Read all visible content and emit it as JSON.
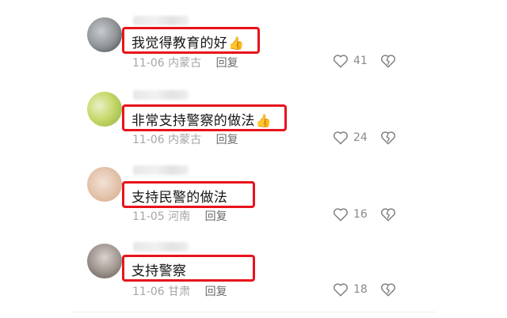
{
  "comments": [
    {
      "text": "我觉得教育的好",
      "has_thumb": true,
      "thumb_glyph": "👍",
      "date": "11-06",
      "location": "内蒙古",
      "reply_label": "回复",
      "likes": "41",
      "avatar_colors": [
        "#bfc3c6",
        "#8b8f93",
        "#3b3d40"
      ]
    },
    {
      "text": "非常支持警察的做法",
      "has_thumb": true,
      "thumb_glyph": "👍",
      "date": "11-06",
      "location": "内蒙古",
      "reply_label": "回复",
      "likes": "24",
      "avatar_colors": [
        "#cfe07a",
        "#9fbf4a",
        "#e9efc9"
      ]
    },
    {
      "text": "支持民警的做法",
      "has_thumb": false,
      "thumb_glyph": "",
      "date": "11-05",
      "location": "河南",
      "reply_label": "回复",
      "likes": "16",
      "avatar_colors": [
        "#e9cdb8",
        "#d8b49a",
        "#f3e2d6"
      ]
    },
    {
      "text": "支持警察",
      "has_thumb": false,
      "thumb_glyph": "",
      "date": "11-06",
      "location": "甘肃",
      "reply_label": "回复",
      "likes": "18",
      "avatar_colors": [
        "#a59a94",
        "#6f6560",
        "#d9d2cf"
      ]
    }
  ],
  "icons": {
    "like": "heart-outline-icon",
    "dislike": "broken-heart-icon"
  },
  "colors": {
    "highlight_border": "#e8131b",
    "meta_text": "#a6a6a6",
    "reply_text": "#6b6b6b"
  }
}
